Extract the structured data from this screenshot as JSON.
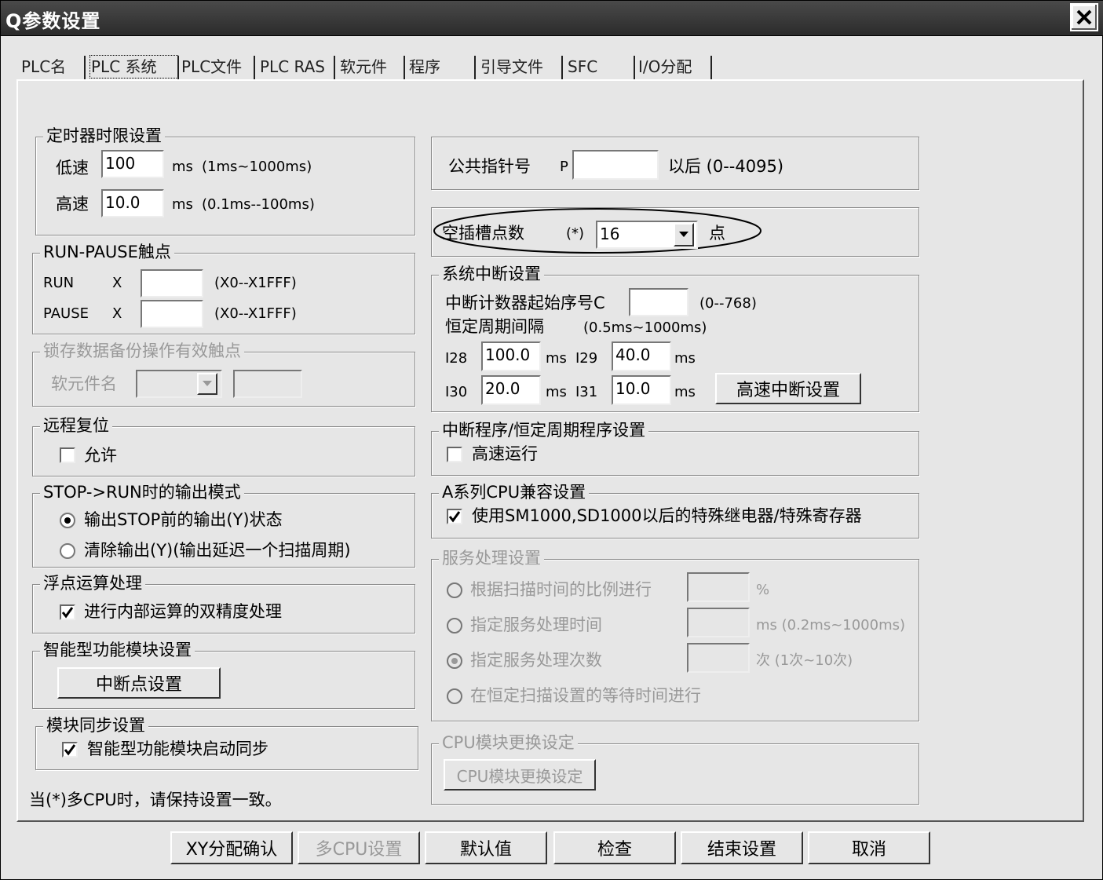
{
  "window": {
    "title": "Q参数设置"
  },
  "tabs": [
    "PLC名",
    "PLC 系统",
    "PLC文件",
    "PLC RAS",
    "软元件",
    "程序",
    "引导文件",
    "SFC",
    "I/O分配"
  ],
  "timer": {
    "title": "定时器时限设置",
    "low_label": "低速",
    "low_value": "100",
    "low_unit": "ms",
    "low_range": "(1ms~1000ms)",
    "high_label": "高速",
    "high_value": "10.0",
    "high_unit": "ms",
    "high_range": "(0.1ms--100ms)"
  },
  "run_pause": {
    "title": "RUN-PAUSE触点",
    "run_label": "RUN",
    "run_prefix": "X",
    "run_value": "",
    "run_range": "(X0--X1FFF)",
    "pause_label": "PAUSE",
    "pause_prefix": "X",
    "pause_value": "",
    "pause_range": "(X0--X1FFF)"
  },
  "latch": {
    "title": "锁存数据备份操作有效触点",
    "device_label": "软元件名",
    "device_value": "",
    "number_value": ""
  },
  "remote_reset": {
    "title": "远程复位",
    "allow_label": "允许",
    "allow_checked": false
  },
  "stop_run": {
    "title": "STOP->RUN时的输出模式",
    "option1": "输出STOP前的输出(Y)状态",
    "option2": "清除输出(Y)(输出延迟一个扫描周期)",
    "selected": 1
  },
  "float": {
    "title": "浮点运算处理",
    "double_label": "进行内部运算的双精度处理",
    "double_checked": true
  },
  "intelligent": {
    "title": "智能型功能模块设置",
    "interrupt_button": "中断点设置"
  },
  "module_sync": {
    "title": "模块同步设置",
    "sync_label": "智能型功能模块启动同步",
    "sync_checked": true
  },
  "note": "当(*)多CPU时，请保持设置一致。",
  "pointer": {
    "label": "公共指针号",
    "prefix": "P",
    "value": "",
    "suffix": "以后 (0--4095)"
  },
  "empty_slot": {
    "label": "空插槽点数",
    "marker": "(*)",
    "value": "16",
    "unit": "点"
  },
  "interrupt": {
    "title": "系统中断设置",
    "counter_label": "中断计数器起始序号C",
    "counter_value": "",
    "counter_range": "(0--768)",
    "period_label": "恒定周期间隔",
    "period_range": "(0.5ms~1000ms)",
    "i28_label": "I28",
    "i28_value": "100.0",
    "i29_label": "I29",
    "i29_value": "40.0",
    "i30_label": "I30",
    "i30_value": "20.0",
    "i31_label": "I31",
    "i31_value": "10.0",
    "unit": "ms",
    "high_speed_button": "高速中断设置"
  },
  "interrupt_program": {
    "title": "中断程序/恒定周期程序设置",
    "fast_label": "高速运行",
    "fast_checked": false
  },
  "a_series": {
    "title": "A系列CPU兼容设置",
    "compat_label": "使用SM1000,SD1000以后的特殊继电器/特殊寄存器",
    "compat_checked": true
  },
  "service": {
    "title": "服务处理设置",
    "option1": "根据扫描时间的比例进行",
    "option1_unit": "%",
    "option2": "指定服务处理时间",
    "option2_unit": "ms (0.2ms~1000ms)",
    "option3": "指定服务处理次数",
    "option3_unit": "次 (1次~10次)",
    "option4": "在恒定扫描设置的等待时间进行",
    "selected": 3
  },
  "cpu_replace": {
    "title": "CPU模块更换设定",
    "button": "CPU模块更换设定"
  },
  "bottom_buttons": [
    "XY分配确认",
    "多CPU设置",
    "默认值",
    "检查",
    "结束设置",
    "取消"
  ]
}
